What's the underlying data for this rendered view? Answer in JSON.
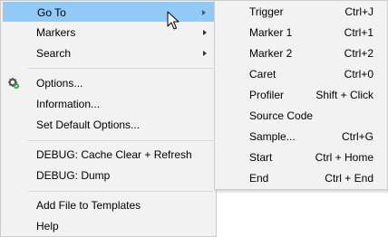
{
  "main_menu": {
    "items": [
      {
        "label": "Go To",
        "has_submenu": true,
        "highlighted": true
      },
      {
        "label": "Markers",
        "has_submenu": true
      },
      {
        "label": "Search",
        "has_submenu": true
      },
      {
        "label": "Options...",
        "icon": "gear-green-check-icon"
      },
      {
        "label": "Information..."
      },
      {
        "label": "Set Default Options..."
      },
      {
        "label": "DEBUG: Cache Clear + Refresh"
      },
      {
        "label": "DEBUG: Dump"
      },
      {
        "label": "Add File to Templates"
      },
      {
        "label": "Help"
      }
    ]
  },
  "submenu": {
    "items": [
      {
        "label": "Trigger",
        "shortcut": "Ctrl+J"
      },
      {
        "label": "Marker 1",
        "shortcut": "Ctrl+1"
      },
      {
        "label": "Marker 2",
        "shortcut": "Ctrl+2"
      },
      {
        "label": "Caret",
        "shortcut": "Ctrl+0"
      },
      {
        "label": "Profiler",
        "shortcut": "Shift + Click"
      },
      {
        "label": "Source Code",
        "shortcut": ""
      },
      {
        "label": "Sample...",
        "shortcut": "Ctrl+G"
      },
      {
        "label": "Start",
        "shortcut": "Ctrl + Home"
      },
      {
        "label": "End",
        "shortcut": "Ctrl + End"
      }
    ]
  },
  "colors": {
    "menu_background": "#f2f2f2",
    "highlight": "#91c9f7",
    "border": "#cccccc",
    "separator": "#d7d7d7"
  }
}
